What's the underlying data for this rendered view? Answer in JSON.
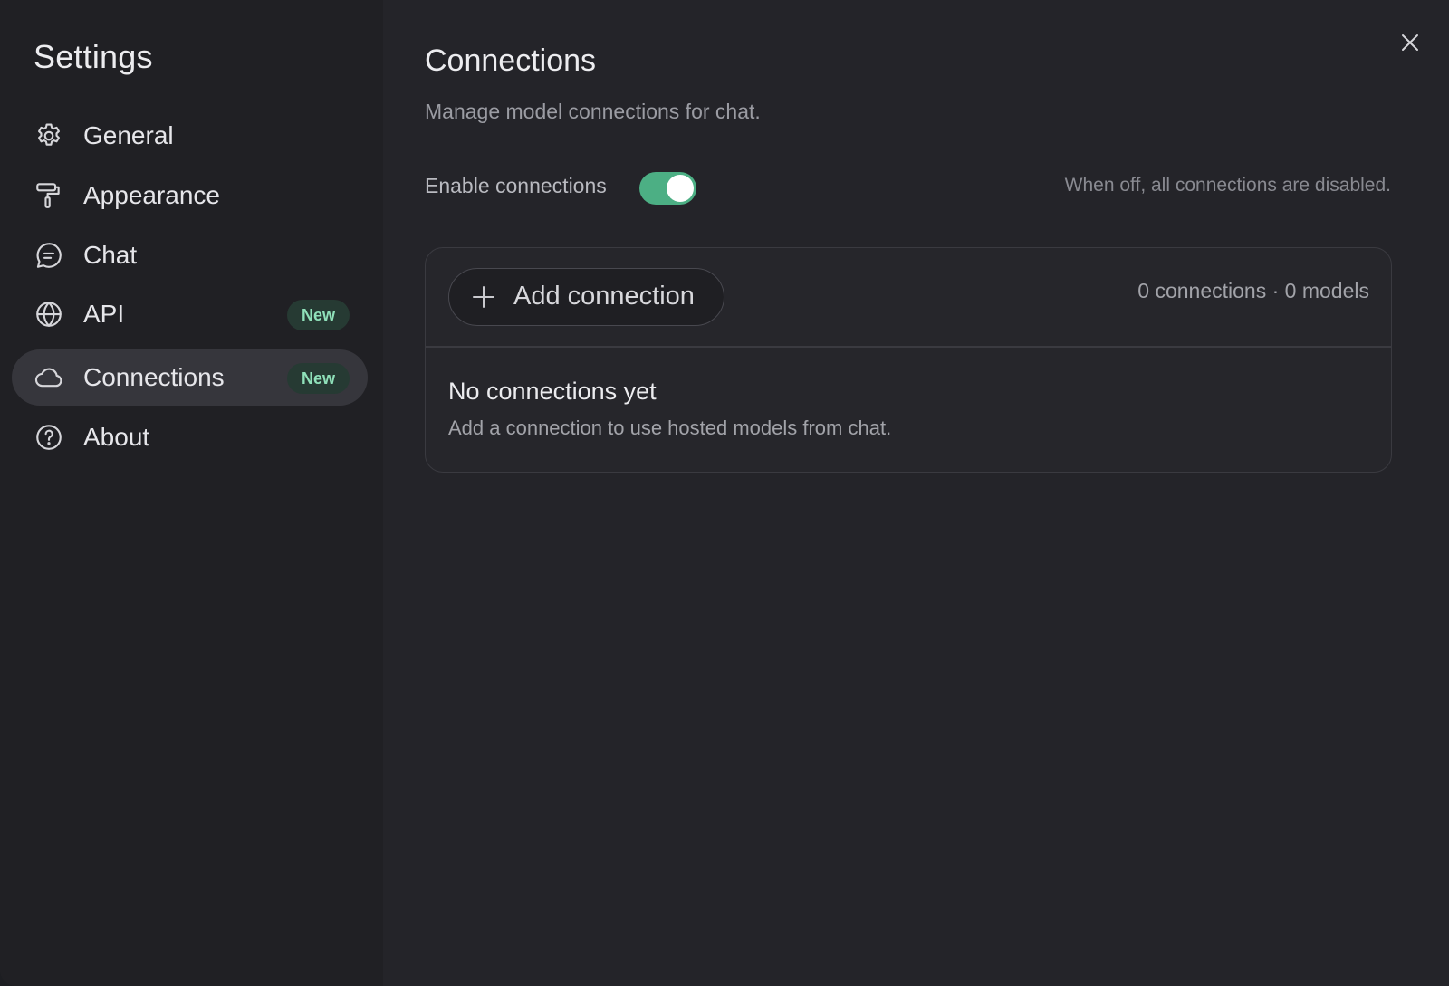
{
  "sidebar": {
    "title": "Settings",
    "items": [
      {
        "label": "General",
        "icon": "gear-icon"
      },
      {
        "label": "Appearance",
        "icon": "paint-roller-icon"
      },
      {
        "label": "Chat",
        "icon": "chat-bubble-icon"
      },
      {
        "label": "API",
        "icon": "globe-icon",
        "badge": "New"
      },
      {
        "label": "Connections",
        "icon": "cloud-icon",
        "badge": "New",
        "active": true
      },
      {
        "label": "About",
        "icon": "question-circle-icon"
      }
    ]
  },
  "main": {
    "title": "Connections",
    "subtitle": "Manage model connections for chat.",
    "toggle": {
      "label": "Enable connections",
      "enabled": true,
      "hint": "When off, all connections are disabled."
    },
    "card": {
      "add_button_label": "Add connection",
      "count_text": "0 connections · 0 models",
      "empty_title": "No connections yet",
      "empty_description": "Add a connection to use hosted models from chat."
    }
  },
  "colors": {
    "toggle_on": "#4caf84",
    "badge_text": "#8fe0b9",
    "badge_bg": "#263a33"
  }
}
